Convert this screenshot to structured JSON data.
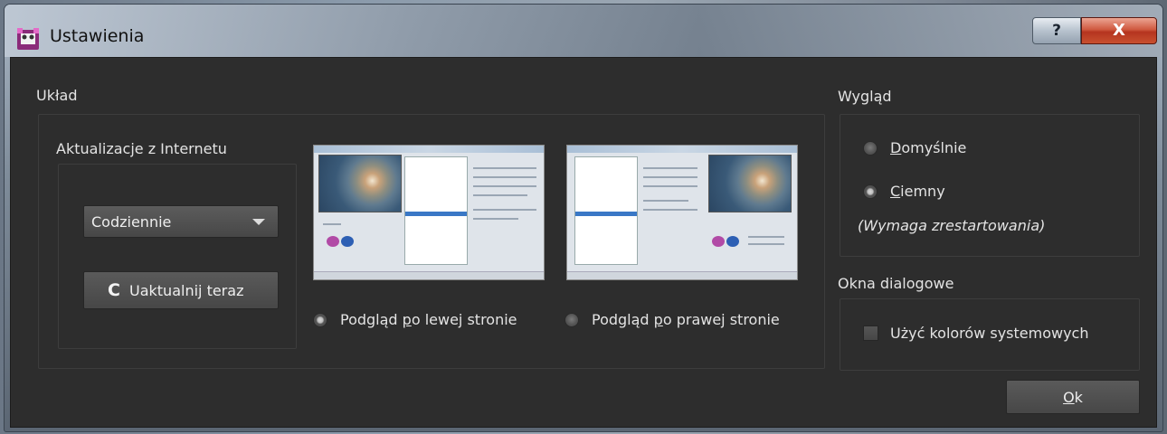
{
  "window": {
    "title": "Ustawienia",
    "help_label": "?",
    "close_label": "X"
  },
  "layout_group": {
    "title": "Układ",
    "updates": {
      "title": "Aktualizacje z Internetu",
      "frequency_value": "Codziennie",
      "update_button_icon": "C",
      "update_button_label": "Uaktualnij teraz"
    },
    "preview_left": {
      "pre": "Podgląd ",
      "accel": "p",
      "post": "o lewej stronie",
      "checked": true
    },
    "preview_right": {
      "pre": "Podgląd ",
      "accel": "p",
      "post": "o prawej stronie",
      "checked": false
    }
  },
  "appearance_group": {
    "title": "Wygląd",
    "default": {
      "accel": "D",
      "rest": "omyślnie",
      "checked": false
    },
    "dark": {
      "accel": "C",
      "rest": "iemny",
      "checked": true
    },
    "note": "(Wymaga zrestartowania)"
  },
  "dialogs_group": {
    "title": "Okna dialogowe",
    "system_colors_label": "Użyć kolorów systemowych",
    "system_colors_checked": false
  },
  "ok_button": {
    "accel": "O",
    "rest": "k"
  },
  "colors": {
    "background": "#2d2d2d",
    "text": "#e3e3e3",
    "close_red": "#c8502f"
  }
}
